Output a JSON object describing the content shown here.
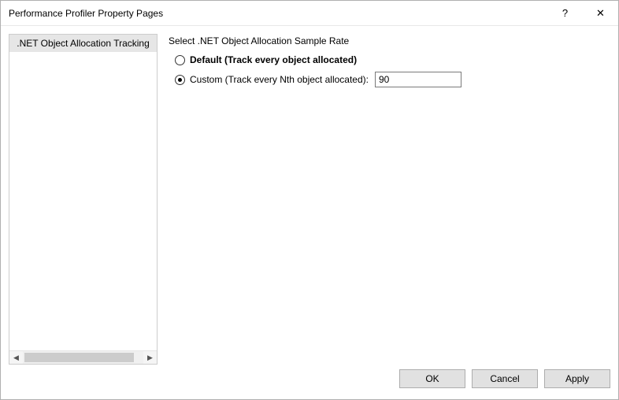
{
  "window": {
    "title": "Performance Profiler Property Pages",
    "help_glyph": "?",
    "close_glyph": "✕"
  },
  "sidebar": {
    "items": [
      {
        "label": ".NET Object Allocation Tracking",
        "selected": true
      }
    ],
    "scroll_left_glyph": "◀",
    "scroll_right_glyph": "▶"
  },
  "content": {
    "section_title": "Select .NET Object Allocation Sample Rate",
    "options": {
      "default": {
        "label": "Default (Track every object allocated)",
        "checked": false
      },
      "custom": {
        "label": "Custom (Track every Nth object allocated):",
        "checked": true,
        "value": "90"
      }
    }
  },
  "footer": {
    "ok": "OK",
    "cancel": "Cancel",
    "apply": "Apply"
  }
}
